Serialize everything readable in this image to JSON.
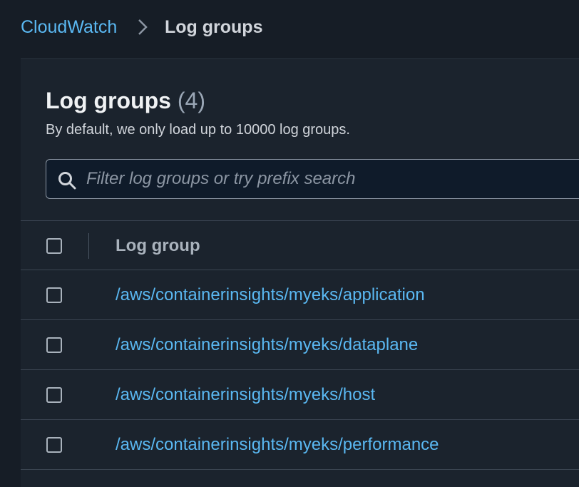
{
  "breadcrumb": {
    "root": "CloudWatch",
    "current": "Log groups"
  },
  "panel": {
    "title": "Log groups",
    "count": "(4)",
    "description": "By default, we only load up to 10000 log groups."
  },
  "search": {
    "placeholder": "Filter log groups or try prefix search",
    "value": ""
  },
  "table": {
    "header": "Log group",
    "rows": [
      "/aws/containerinsights/myeks/application",
      "/aws/containerinsights/myeks/dataplane",
      "/aws/containerinsights/myeks/host",
      "/aws/containerinsights/myeks/performance"
    ]
  },
  "colors": {
    "background": "#161d26",
    "panel": "#1b232d",
    "link": "#5ab8f2",
    "text": "#d1d5db"
  }
}
